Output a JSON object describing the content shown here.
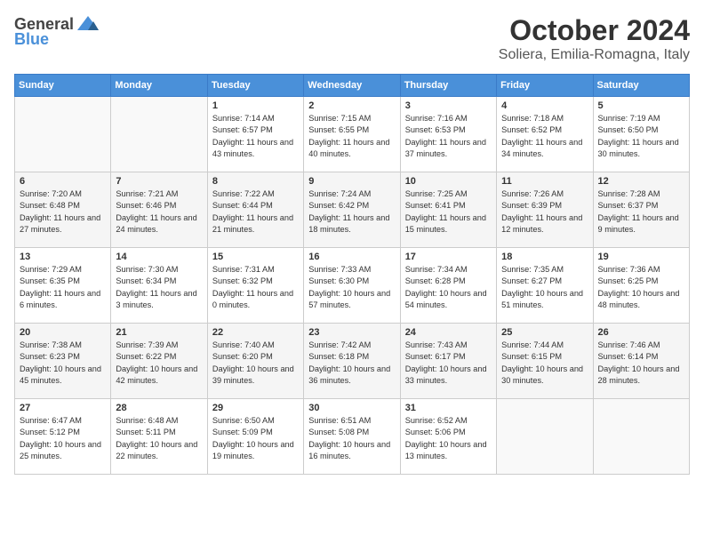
{
  "header": {
    "logo_general": "General",
    "logo_blue": "Blue",
    "month_title": "October 2024",
    "location": "Soliera, Emilia-Romagna, Italy"
  },
  "weekdays": [
    "Sunday",
    "Monday",
    "Tuesday",
    "Wednesday",
    "Thursday",
    "Friday",
    "Saturday"
  ],
  "weeks": [
    [
      {
        "day": "",
        "info": ""
      },
      {
        "day": "",
        "info": ""
      },
      {
        "day": "1",
        "info": "Sunrise: 7:14 AM\nSunset: 6:57 PM\nDaylight: 11 hours and 43 minutes."
      },
      {
        "day": "2",
        "info": "Sunrise: 7:15 AM\nSunset: 6:55 PM\nDaylight: 11 hours and 40 minutes."
      },
      {
        "day": "3",
        "info": "Sunrise: 7:16 AM\nSunset: 6:53 PM\nDaylight: 11 hours and 37 minutes."
      },
      {
        "day": "4",
        "info": "Sunrise: 7:18 AM\nSunset: 6:52 PM\nDaylight: 11 hours and 34 minutes."
      },
      {
        "day": "5",
        "info": "Sunrise: 7:19 AM\nSunset: 6:50 PM\nDaylight: 11 hours and 30 minutes."
      }
    ],
    [
      {
        "day": "6",
        "info": "Sunrise: 7:20 AM\nSunset: 6:48 PM\nDaylight: 11 hours and 27 minutes."
      },
      {
        "day": "7",
        "info": "Sunrise: 7:21 AM\nSunset: 6:46 PM\nDaylight: 11 hours and 24 minutes."
      },
      {
        "day": "8",
        "info": "Sunrise: 7:22 AM\nSunset: 6:44 PM\nDaylight: 11 hours and 21 minutes."
      },
      {
        "day": "9",
        "info": "Sunrise: 7:24 AM\nSunset: 6:42 PM\nDaylight: 11 hours and 18 minutes."
      },
      {
        "day": "10",
        "info": "Sunrise: 7:25 AM\nSunset: 6:41 PM\nDaylight: 11 hours and 15 minutes."
      },
      {
        "day": "11",
        "info": "Sunrise: 7:26 AM\nSunset: 6:39 PM\nDaylight: 11 hours and 12 minutes."
      },
      {
        "day": "12",
        "info": "Sunrise: 7:28 AM\nSunset: 6:37 PM\nDaylight: 11 hours and 9 minutes."
      }
    ],
    [
      {
        "day": "13",
        "info": "Sunrise: 7:29 AM\nSunset: 6:35 PM\nDaylight: 11 hours and 6 minutes."
      },
      {
        "day": "14",
        "info": "Sunrise: 7:30 AM\nSunset: 6:34 PM\nDaylight: 11 hours and 3 minutes."
      },
      {
        "day": "15",
        "info": "Sunrise: 7:31 AM\nSunset: 6:32 PM\nDaylight: 11 hours and 0 minutes."
      },
      {
        "day": "16",
        "info": "Sunrise: 7:33 AM\nSunset: 6:30 PM\nDaylight: 10 hours and 57 minutes."
      },
      {
        "day": "17",
        "info": "Sunrise: 7:34 AM\nSunset: 6:28 PM\nDaylight: 10 hours and 54 minutes."
      },
      {
        "day": "18",
        "info": "Sunrise: 7:35 AM\nSunset: 6:27 PM\nDaylight: 10 hours and 51 minutes."
      },
      {
        "day": "19",
        "info": "Sunrise: 7:36 AM\nSunset: 6:25 PM\nDaylight: 10 hours and 48 minutes."
      }
    ],
    [
      {
        "day": "20",
        "info": "Sunrise: 7:38 AM\nSunset: 6:23 PM\nDaylight: 10 hours and 45 minutes."
      },
      {
        "day": "21",
        "info": "Sunrise: 7:39 AM\nSunset: 6:22 PM\nDaylight: 10 hours and 42 minutes."
      },
      {
        "day": "22",
        "info": "Sunrise: 7:40 AM\nSunset: 6:20 PM\nDaylight: 10 hours and 39 minutes."
      },
      {
        "day": "23",
        "info": "Sunrise: 7:42 AM\nSunset: 6:18 PM\nDaylight: 10 hours and 36 minutes."
      },
      {
        "day": "24",
        "info": "Sunrise: 7:43 AM\nSunset: 6:17 PM\nDaylight: 10 hours and 33 minutes."
      },
      {
        "day": "25",
        "info": "Sunrise: 7:44 AM\nSunset: 6:15 PM\nDaylight: 10 hours and 30 minutes."
      },
      {
        "day": "26",
        "info": "Sunrise: 7:46 AM\nSunset: 6:14 PM\nDaylight: 10 hours and 28 minutes."
      }
    ],
    [
      {
        "day": "27",
        "info": "Sunrise: 6:47 AM\nSunset: 5:12 PM\nDaylight: 10 hours and 25 minutes."
      },
      {
        "day": "28",
        "info": "Sunrise: 6:48 AM\nSunset: 5:11 PM\nDaylight: 10 hours and 22 minutes."
      },
      {
        "day": "29",
        "info": "Sunrise: 6:50 AM\nSunset: 5:09 PM\nDaylight: 10 hours and 19 minutes."
      },
      {
        "day": "30",
        "info": "Sunrise: 6:51 AM\nSunset: 5:08 PM\nDaylight: 10 hours and 16 minutes."
      },
      {
        "day": "31",
        "info": "Sunrise: 6:52 AM\nSunset: 5:06 PM\nDaylight: 10 hours and 13 minutes."
      },
      {
        "day": "",
        "info": ""
      },
      {
        "day": "",
        "info": ""
      }
    ]
  ]
}
